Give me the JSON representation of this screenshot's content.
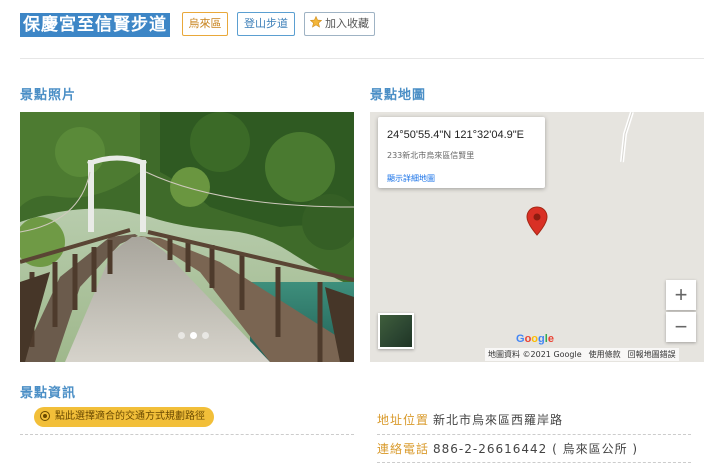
{
  "header": {
    "title": "保慶宮至信賢步道",
    "tags": {
      "district": "烏來區",
      "trail": "登山步道",
      "favorite": "加入收藏"
    }
  },
  "sections": {
    "photo": "景點照片",
    "map": "景點地圖",
    "info": "景點資訊"
  },
  "photo": {
    "slide_count": 3,
    "active_slide": 2
  },
  "map": {
    "coords": "24°50'55.4\"N 121°32'04.9\"E",
    "address": "233新北市烏來區信賢里",
    "detail_link": "顯示詳細地圖",
    "zoom_in": "+",
    "zoom_out": "−",
    "google_logo": "Google",
    "attribution": {
      "data": "地圖資料 ©2021 Google",
      "terms": "使用條款",
      "report": "回報地圖錯誤"
    },
    "pin_color": "#d93025"
  },
  "info": {
    "route_button": "點此選擇適合的交通方式規劃路徑",
    "address_label": "地址位置",
    "address_value": "新北市烏來區西羅岸路",
    "phone_label": "連絡電話",
    "phone_value": "886-2-26616442 ( 烏來區公所 )"
  },
  "colors": {
    "accent": "#3d86c6",
    "label": "#d99a2b",
    "button": "#f2bf39"
  }
}
